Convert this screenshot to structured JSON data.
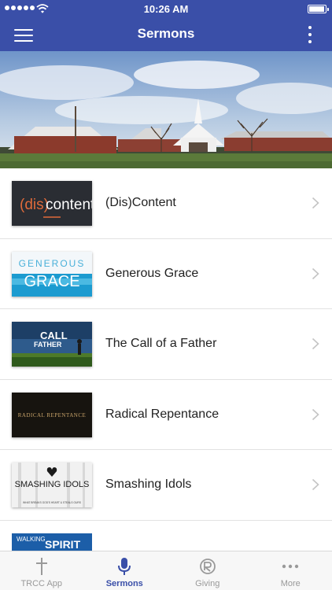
{
  "status_bar": {
    "time": "10:26 AM"
  },
  "header": {
    "title": "Sermons"
  },
  "sermons": [
    {
      "title": "(Dis)Content",
      "thumb_text": [
        "(dis)",
        "content"
      ]
    },
    {
      "title": "Generous Grace",
      "thumb_text": [
        "GENEROUS",
        "GRACE"
      ]
    },
    {
      "title": "The Call of a Father",
      "thumb_text": [
        "CALL",
        "FATHER"
      ]
    },
    {
      "title": "Radical Repentance",
      "thumb_text": [
        "RADICAL REPENTANCE"
      ]
    },
    {
      "title": "Smashing Idols",
      "thumb_text": [
        "SMASHING IDOLS",
        "WHAT BREAKS GOD'S HEART & STEALS OURS"
      ]
    }
  ],
  "partial_sermon": {
    "thumb_text": [
      "WALKING",
      "SPIRIT"
    ]
  },
  "tabs": [
    {
      "label": "TRCC App",
      "icon": "cross-icon",
      "active": false
    },
    {
      "label": "Sermons",
      "icon": "microphone-icon",
      "active": true
    },
    {
      "label": "Giving",
      "icon": "giving-icon",
      "active": false
    },
    {
      "label": "More",
      "icon": "ellipsis-icon",
      "active": false
    }
  ],
  "colors": {
    "header": "#3a4fa8",
    "tab_active": "#3a4fa8",
    "tab_inactive": "#999999"
  }
}
